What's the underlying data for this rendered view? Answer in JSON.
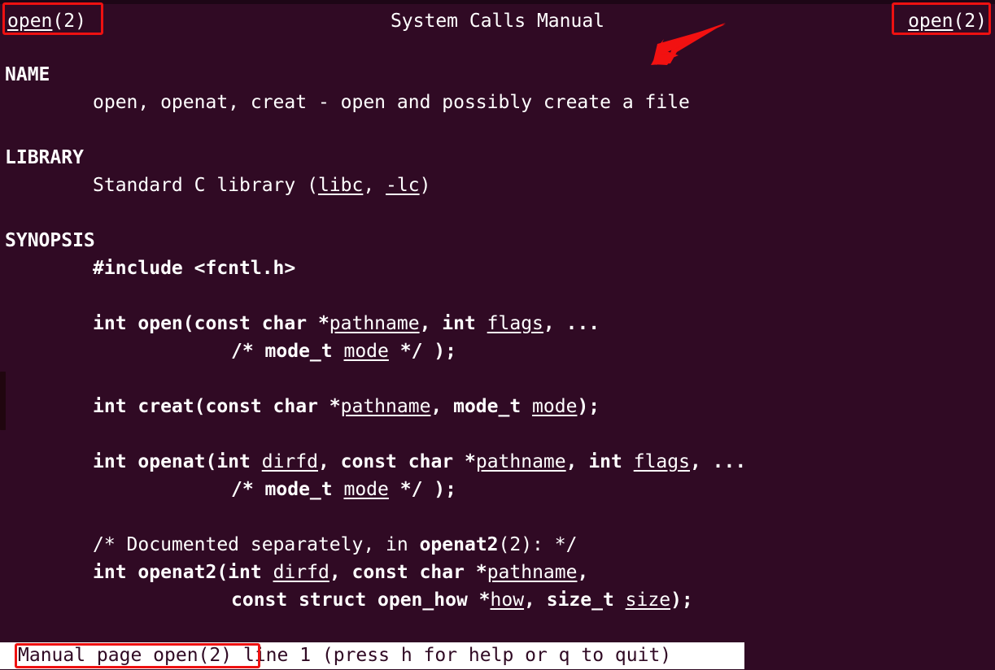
{
  "terminal": {
    "background_color": "#300a24",
    "foreground_color": "#ffffff"
  },
  "header": {
    "left": {
      "name": "open",
      "section": "(2)"
    },
    "center": "System Calls Manual",
    "right": {
      "name": "open",
      "section": "(2)"
    }
  },
  "sections": {
    "name": {
      "heading": "NAME",
      "body": "open, openat, creat - open and possibly create a file"
    },
    "library": {
      "heading": "LIBRARY",
      "body_pre": "Standard C library (",
      "link1": "libc",
      "body_mid": ", ",
      "link2": "-lc",
      "body_post": ")"
    },
    "synopsis": {
      "heading": "SYNOPSIS",
      "include_line": "#include <fcntl.h>",
      "open_line1_a": "int open(const char *",
      "open_line1_pathname": "pathname",
      "open_line1_b": ", int ",
      "open_line1_flags": "flags",
      "open_line1_c": ", ...",
      "open_line2_a": "/* mode_t ",
      "open_line2_mode": "mode",
      "open_line2_b": " */ );",
      "creat_line_a": "int creat(const char *",
      "creat_line_pathname": "pathname",
      "creat_line_b": ", mode_t ",
      "creat_line_mode": "mode",
      "creat_line_c": ");",
      "openat_line1_a": "int openat(int ",
      "openat_line1_dirfd": "dirfd",
      "openat_line1_b": ", const char *",
      "openat_line1_pathname": "pathname",
      "openat_line1_c": ", int ",
      "openat_line1_flags": "flags",
      "openat_line1_d": ", ...",
      "openat_line2_a": "/* mode_t ",
      "openat_line2_mode": "mode",
      "openat_line2_b": " */ );",
      "comment_a": "/* Documented separately, in ",
      "comment_bold": "openat2",
      "comment_b": "(2): */",
      "openat2_line1_a": "int openat2(int ",
      "openat2_line1_dirfd": "dirfd",
      "openat2_line1_b": ", const char *",
      "openat2_line1_pathname": "pathname",
      "openat2_line1_c": ",",
      "openat2_line2_a": "const struct open_how *",
      "openat2_line2_how": "how",
      "openat2_line2_b": ", size_t ",
      "openat2_line2_size": "size",
      "openat2_line2_c": ");"
    }
  },
  "status_bar": {
    "highlighted": "Manual page open(2)",
    "rest": " line 1 (press h for help or q to quit)"
  },
  "annotations": {
    "color": "#ee1111",
    "box_header_left": "open(2)",
    "box_header_right": "open(2)",
    "box_status": "Manual page open(2)",
    "arrow": "red-arrow-pointing-left-down"
  }
}
